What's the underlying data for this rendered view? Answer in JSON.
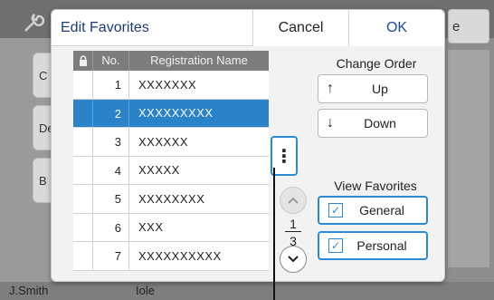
{
  "dialog": {
    "title": "Edit Favorites",
    "cancel_label": "Cancel",
    "ok_label": "OK"
  },
  "table": {
    "columns": {
      "no": "No.",
      "name": "Registration Name"
    },
    "rows": [
      {
        "no": "1",
        "name": "XXXXXXX",
        "selected": false
      },
      {
        "no": "2",
        "name": "XXXXXXXXX",
        "selected": true
      },
      {
        "no": "3",
        "name": "XXXXXX",
        "selected": false
      },
      {
        "no": "4",
        "name": "XXXXX",
        "selected": false
      },
      {
        "no": "5",
        "name": "XXXXXXXX",
        "selected": false
      },
      {
        "no": "6",
        "name": "XXX",
        "selected": false
      },
      {
        "no": "7",
        "name": "XXXXXXXXXX",
        "selected": false
      }
    ]
  },
  "pager": {
    "current": "1",
    "total": "3"
  },
  "menu_icon": "vertical-ellipsis-icon",
  "change_order": {
    "label": "Change Order",
    "up_label": "Up",
    "down_label": "Down"
  },
  "view_favorites": {
    "label": "View Favorites",
    "general_label": "General",
    "general_checked": true,
    "personal_label": "Personal",
    "personal_checked": true
  },
  "background": {
    "user": "J.Smith",
    "title_fragment": "Iole",
    "left_items": [
      "C",
      "De",
      "B"
    ],
    "right_button_text": "e"
  },
  "colors": {
    "accent": "#2a8ad6",
    "selected_row": "#2a82c8",
    "title": "#1c3c78"
  }
}
